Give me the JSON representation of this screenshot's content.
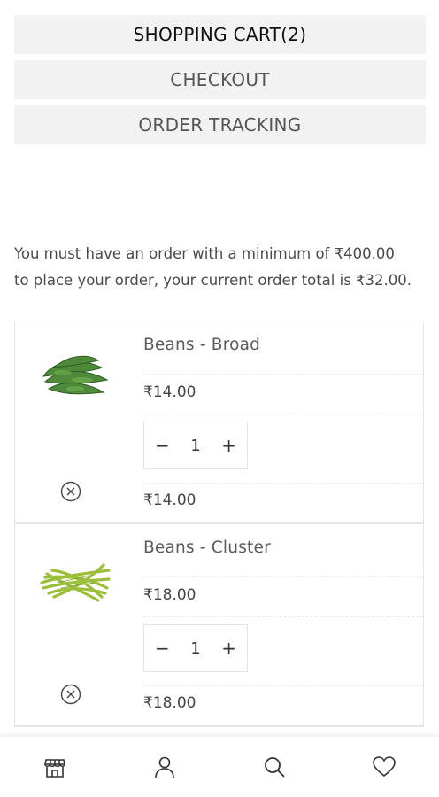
{
  "steps": {
    "cart": "SHOPPING CART(2)",
    "checkout": "CHECKOUT",
    "tracking": "ORDER TRACKING"
  },
  "notice": "You must have an order with a minimum of ₹400.00 to place your order, your current order total is ₹32.00.",
  "cart": {
    "items": [
      {
        "name": "Beans - Broad",
        "price": "₹14.00",
        "quantity": "1",
        "subtotal": "₹14.00",
        "icon": "broad-beans-image"
      },
      {
        "name": "Beans - Cluster",
        "price": "₹18.00",
        "quantity": "1",
        "subtotal": "₹18.00",
        "icon": "cluster-beans-image"
      }
    ],
    "minus_label": "−",
    "plus_label": "+"
  },
  "bottom_nav": [
    {
      "icon": "store-icon"
    },
    {
      "icon": "user-icon"
    },
    {
      "icon": "search-icon"
    },
    {
      "icon": "heart-icon"
    }
  ],
  "colors": {
    "tab_background": "#f2f2f2",
    "bean_broad": "#4e8a3a",
    "bean_cluster": "#9bbf3a"
  }
}
